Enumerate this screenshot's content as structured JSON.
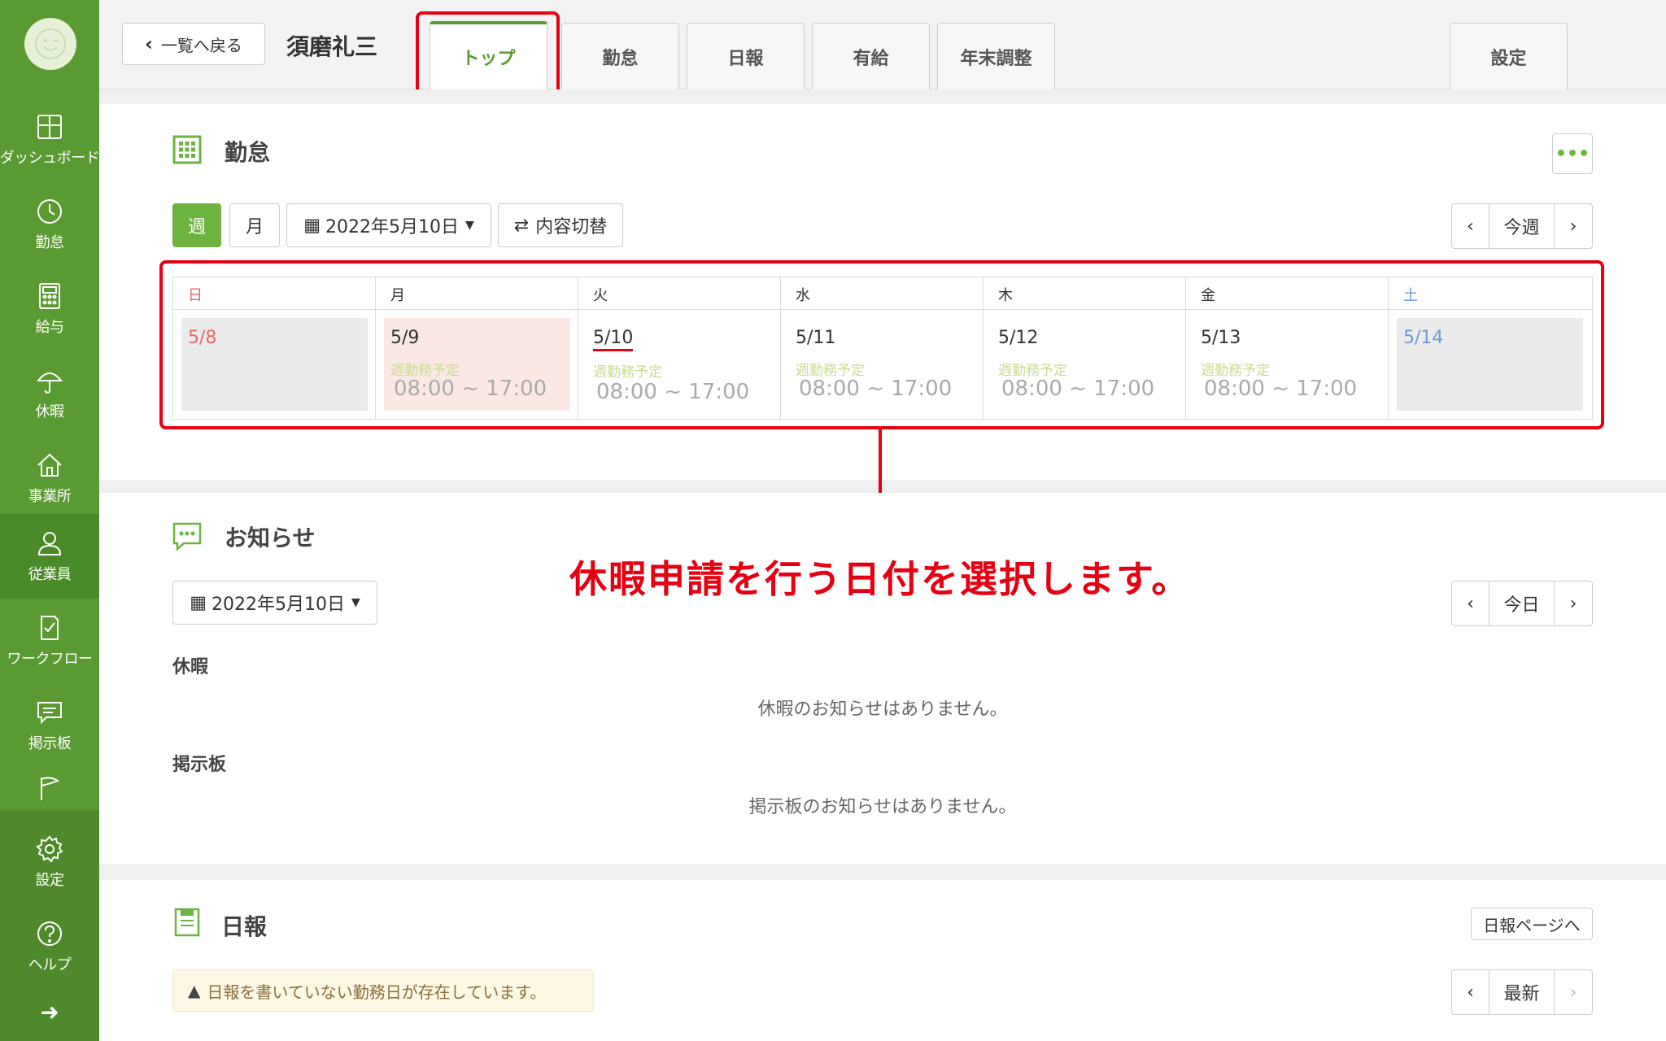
{
  "sidebar": {
    "items": [
      {
        "label": "ダッシュボード",
        "icon": "dashboard-icon"
      },
      {
        "label": "勤怠",
        "icon": "clock-icon"
      },
      {
        "label": "給与",
        "icon": "calculator-icon"
      },
      {
        "label": "休暇",
        "icon": "umbrella-icon"
      },
      {
        "label": "事業所",
        "icon": "home-icon"
      },
      {
        "label": "従業員",
        "icon": "user-icon"
      },
      {
        "label": "ワークフロー",
        "icon": "checklist-icon"
      },
      {
        "label": "掲示板",
        "icon": "chat-icon"
      },
      {
        "label": "",
        "icon": "flag-icon"
      },
      {
        "label": "設定",
        "icon": "gear-icon"
      },
      {
        "label": "ヘルプ",
        "icon": "help-icon"
      }
    ],
    "collapse_icon": "arrow-right-icon"
  },
  "header": {
    "back_label": "一覧へ戻る",
    "employee_name": "須磨礼三",
    "tabs": [
      "トップ",
      "勤怠",
      "日報",
      "有給",
      "年末調整"
    ],
    "settings_tab": "設定"
  },
  "attendance": {
    "title": "勤怠",
    "more_label": "•••",
    "view_week": "週",
    "view_month": "月",
    "date_picker": "2022年5月10日",
    "toggle_label": "内容切替",
    "nav_prev": "‹",
    "nav_current": "今週",
    "nav_next": "›",
    "days": [
      {
        "weekday": "日",
        "date": "5/8",
        "plan": "",
        "time": ""
      },
      {
        "weekday": "月",
        "date": "5/9",
        "plan": "週勤務予定",
        "time": "08:00 ~ 17:00"
      },
      {
        "weekday": "火",
        "date": "5/10",
        "plan": "週勤務予定",
        "time": "08:00 ~ 17:00"
      },
      {
        "weekday": "水",
        "date": "5/11",
        "plan": "週勤務予定",
        "time": "08:00 ~ 17:00"
      },
      {
        "weekday": "木",
        "date": "5/12",
        "plan": "週勤務予定",
        "time": "08:00 ~ 17:00"
      },
      {
        "weekday": "金",
        "date": "5/13",
        "plan": "週勤務予定",
        "time": "08:00 ~ 17:00"
      },
      {
        "weekday": "土",
        "date": "5/14",
        "plan": "",
        "time": ""
      }
    ]
  },
  "annotation": "休暇申請を行う日付を選択します。",
  "notices": {
    "title": "お知らせ",
    "date_picker": "2022年5月10日",
    "nav_prev": "‹",
    "nav_current": "今日",
    "nav_next": "›",
    "leave_label": "休暇",
    "leave_empty": "休暇のお知らせはありません。",
    "board_label": "掲示板",
    "board_empty": "掲示板のお知らせはありません。"
  },
  "daily_report": {
    "title": "日報",
    "page_link": "日報ページへ",
    "alert": "日報を書いていない勤務日が存在しています。",
    "nav_prev": "‹",
    "nav_current": "最新",
    "nav_next": "›"
  },
  "colors": {
    "brand_green": "#5a9a33",
    "highlight_red": "#e60012",
    "sunday_red": "#e36a6a",
    "saturday_blue": "#6a9bd8"
  }
}
